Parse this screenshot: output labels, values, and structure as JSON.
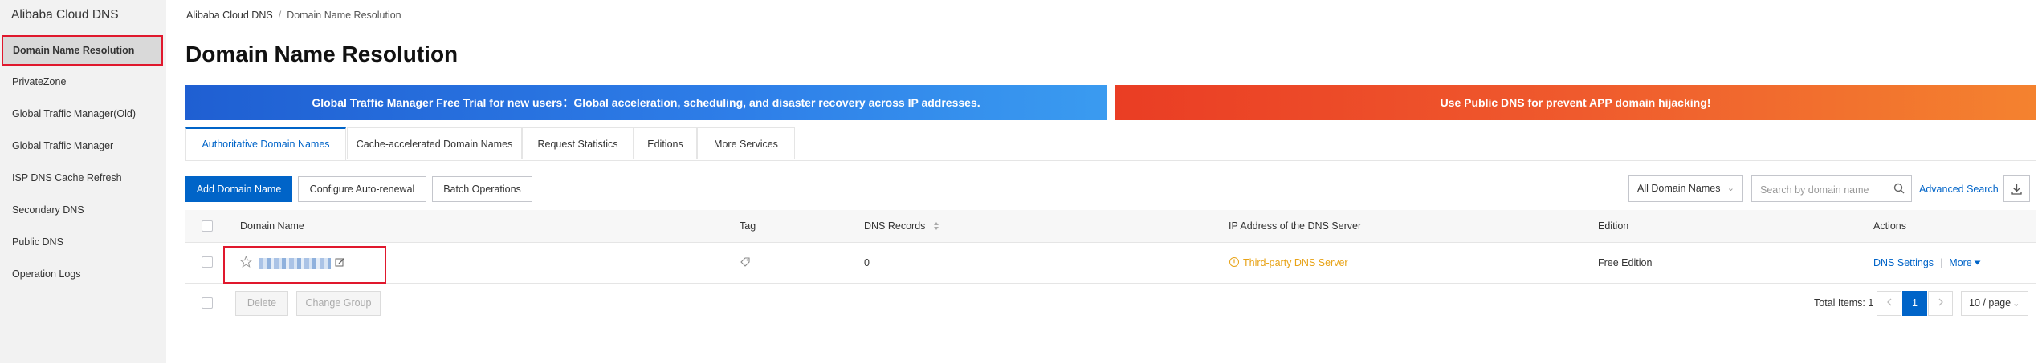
{
  "sidebar": {
    "title": "Alibaba Cloud DNS",
    "items": [
      {
        "label": "Domain Name Resolution"
      },
      {
        "label": "PrivateZone"
      },
      {
        "label": "Global Traffic Manager(Old)"
      },
      {
        "label": "Global Traffic Manager"
      },
      {
        "label": "ISP DNS Cache Refresh"
      },
      {
        "label": "Secondary DNS"
      },
      {
        "label": "Public DNS"
      },
      {
        "label": "Operation Logs"
      }
    ]
  },
  "breadcrumb": [
    "Alibaba Cloud DNS",
    "/",
    "Domain Name Resolution"
  ],
  "page_title": "Domain Name Resolution",
  "banners": [
    "Global Traffic Manager Free Trial for new users：Global acceleration, scheduling, and disaster recovery across IP addresses.",
    "Use Public DNS for prevent APP domain hijacking!"
  ],
  "tabs": [
    {
      "label": "Authoritative Domain Names",
      "active": true
    },
    {
      "label": "Cache-accelerated Domain Names"
    },
    {
      "label": "Request Statistics"
    },
    {
      "label": "Editions"
    },
    {
      "label": "More Services"
    }
  ],
  "toolbar": {
    "add_domain": "Add Domain Name",
    "auto_renewal": "Configure Auto-renewal",
    "batch": "Batch Operations",
    "filter_selected": "All Domain Names",
    "search_placeholder": "Search by domain name",
    "advanced_search": "Advanced Search"
  },
  "table": {
    "columns": [
      "Domain Name",
      "Tag",
      "DNS Records",
      "IP Address of the DNS Server",
      "Edition",
      "Actions"
    ],
    "rows": [
      {
        "domain": "",
        "dns_records": "0",
        "dns_server": "Third-party DNS Server",
        "edition": "Free Edition",
        "actions": [
          "DNS Settings",
          "|",
          "More"
        ]
      }
    ]
  },
  "footer": {
    "delete": "Delete",
    "change_group": "Change Group",
    "total": "Total Items: 1",
    "current_page": "1",
    "page_size": "10 / page"
  },
  "colors": {
    "primary": "#0064c8",
    "highlight_border": "#e0182d",
    "warning": "#e8a317"
  }
}
